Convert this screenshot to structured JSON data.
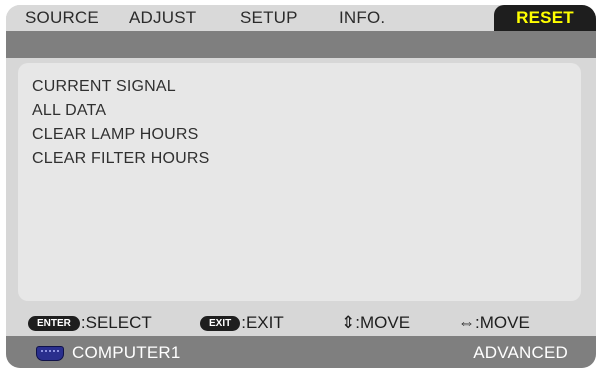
{
  "tabs": [
    {
      "label": "SOURCE"
    },
    {
      "label": "ADJUST"
    },
    {
      "label": "SETUP"
    },
    {
      "label": "INFO."
    },
    {
      "label": "RESET"
    }
  ],
  "active_tab": "RESET",
  "items": [
    {
      "label": "CURRENT SIGNAL"
    },
    {
      "label": "ALL DATA"
    },
    {
      "label": "CLEAR LAMP HOURS"
    },
    {
      "label": "CLEAR FILTER HOURS"
    }
  ],
  "help": {
    "enter_key": "ENTER",
    "enter_action": ":SELECT",
    "exit_key": "EXIT",
    "exit_action": ":EXIT",
    "updown_symbol": "⇕",
    "updown_action": ":MOVE",
    "leftright_symbol": "⇔",
    "leftright_action": ":MOVE"
  },
  "status": {
    "source_icon": "computer-connector-icon",
    "source": "COMPUTER1",
    "mode": "ADVANCED"
  },
  "colors": {
    "active_tab_text": "#ffff00",
    "active_tab_bg": "#1e1e1e",
    "strip": "#7f7f7f",
    "frame": "#d7d7d7",
    "panel": "#e7e7e7"
  }
}
